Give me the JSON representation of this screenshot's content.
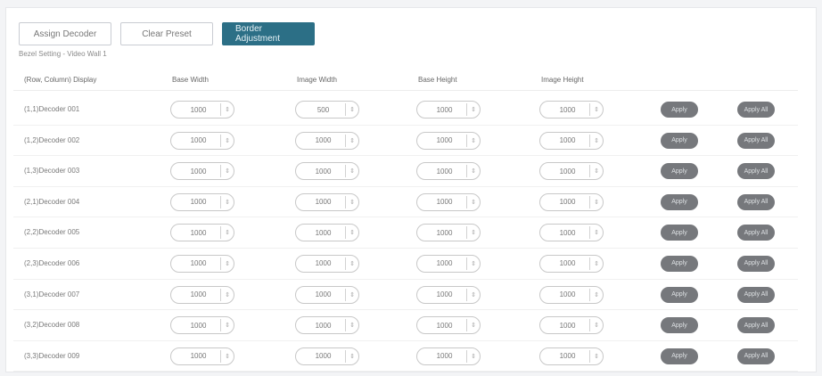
{
  "toolbar": {
    "assign_decoder": "Assign Decoder",
    "clear_preset": "Clear Preset",
    "border_adjustment": "Border Adjustment"
  },
  "breadcrumb": "Bezel Setting - Video Wall 1",
  "table": {
    "headers": [
      "(Row, Column) Display",
      "Base Width",
      "Image Width",
      "Base Height",
      "Image Height"
    ],
    "apply_label": "Apply",
    "apply_all_label": "Apply All",
    "rows": [
      {
        "display": "(1,1)Decoder 001",
        "base_width": "1000",
        "image_width": "500",
        "base_height": "1000",
        "image_height": "1000"
      },
      {
        "display": "(1,2)Decoder 002",
        "base_width": "1000",
        "image_width": "1000",
        "base_height": "1000",
        "image_height": "1000"
      },
      {
        "display": "(1,3)Decoder 003",
        "base_width": "1000",
        "image_width": "1000",
        "base_height": "1000",
        "image_height": "1000"
      },
      {
        "display": "(2,1)Decoder 004",
        "base_width": "1000",
        "image_width": "1000",
        "base_height": "1000",
        "image_height": "1000"
      },
      {
        "display": "(2,2)Decoder 005",
        "base_width": "1000",
        "image_width": "1000",
        "base_height": "1000",
        "image_height": "1000"
      },
      {
        "display": "(2,3)Decoder 006",
        "base_width": "1000",
        "image_width": "1000",
        "base_height": "1000",
        "image_height": "1000"
      },
      {
        "display": "(3,1)Decoder 007",
        "base_width": "1000",
        "image_width": "1000",
        "base_height": "1000",
        "image_height": "1000"
      },
      {
        "display": "(3,2)Decoder 008",
        "base_width": "1000",
        "image_width": "1000",
        "base_height": "1000",
        "image_height": "1000"
      },
      {
        "display": "(3,3)Decoder 009",
        "base_width": "1000",
        "image_width": "1000",
        "base_height": "1000",
        "image_height": "1000"
      }
    ]
  },
  "colors": {
    "accent": "#2c6f86",
    "pill": "#76787c"
  },
  "icons": {
    "spinner": "stepper-icon"
  }
}
